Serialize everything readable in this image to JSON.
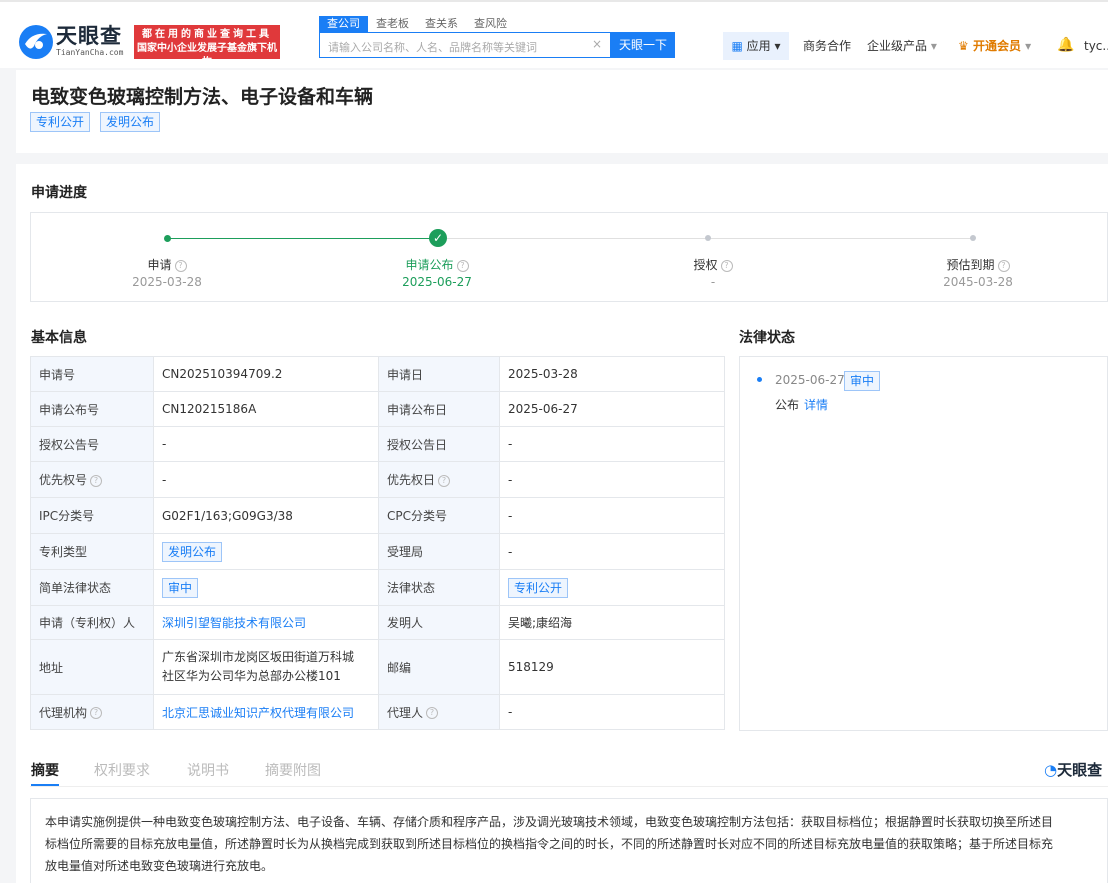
{
  "brand": {
    "name": "天眼查",
    "sub": "TianYanCha.com",
    "slogan1": "都在用的商业查询工具",
    "slogan2": "国家中小企业发展子基金旗下机构"
  },
  "search": {
    "tabs": [
      "查公司",
      "查老板",
      "查关系",
      "查风险"
    ],
    "placeholder": "请输入公司名称、人名、品牌名称等关键词",
    "clear": "×",
    "button": "天眼一下"
  },
  "nav": {
    "apps": "应用",
    "business": "商务合作",
    "enterprise": "企业级产品",
    "vip": "开通会员",
    "user": "tyc..."
  },
  "patent": {
    "title": "电致变色玻璃控制方法、电子设备和车辆",
    "tags": [
      "专利公开",
      "发明公布"
    ]
  },
  "progress": {
    "title": "申请进度",
    "stages": [
      {
        "name": "申请",
        "date": "2025-03-28"
      },
      {
        "name": "申请公布",
        "date": "2025-06-27"
      },
      {
        "name": "授权",
        "date": "-"
      },
      {
        "name": "预估到期",
        "date": "2045-03-28"
      }
    ]
  },
  "basic": {
    "title": "基本信息",
    "rows": [
      {
        "k1": "申请号",
        "v1": "CN202510394709.2",
        "k2": "申请日",
        "v2": "2025-03-28"
      },
      {
        "k1": "申请公布号",
        "v1": "CN120215186A",
        "k2": "申请公布日",
        "v2": "2025-06-27"
      },
      {
        "k1": "授权公告号",
        "v1": "-",
        "k2": "授权公告日",
        "v2": "-"
      },
      {
        "k1": "优先权号",
        "v1": "-",
        "k2": "优先权日",
        "v2": "-"
      },
      {
        "k1": "IPC分类号",
        "v1": "G02F1/163;G09G3/38",
        "k2": "CPC分类号",
        "v2": "-"
      },
      {
        "k1": "专利类型",
        "v1": "发明公布",
        "k2": "受理局",
        "v2": "-"
      },
      {
        "k1": "简单法律状态",
        "v1": "审中",
        "k2": "法律状态",
        "v2": "专利公开"
      },
      {
        "k1": "申请（专利权）人",
        "v1": "深圳引望智能技术有限公司",
        "k2": "发明人",
        "v2": "吴曦;康绍海"
      },
      {
        "k1": "地址",
        "v1a": "广东省深圳市龙岗区坂田街道万科城",
        "v1b": "社区华为公司华为总部办公楼101",
        "k2": "邮编",
        "v2": "518129"
      },
      {
        "k1": "代理机构",
        "v1": "北京汇思诚业知识产权代理有限公司",
        "k2": "代理人",
        "v2": "-"
      }
    ]
  },
  "legal": {
    "title": "法律状态",
    "date": "2025-06-27",
    "badge": "审中",
    "event": "公布",
    "detail": "详情"
  },
  "tabs2": {
    "abstract": "摘要",
    "claims": "权利要求",
    "manual": "说明书",
    "drawing": "摘要附图",
    "brand": "天眼查"
  },
  "abstract": {
    "line1": "本申请实施例提供一种电致变色玻璃控制方法、电子设备、车辆、存储介质和程序产品，涉及调光玻璃技术领域，电致变色玻璃控制方法包括：获取目标档位；根据静置时长获取切换至所述目",
    "line2": "标档位所需要的目标充放电量值，所述静置时长为从换档完成到获取到所述目标档位的换档指令之间的时长，不同的所述静置时长对应不同的所述目标充放电量值的获取策略；基于所述目标充",
    "line3": "放电量值对所述电致变色玻璃进行充放电。"
  }
}
